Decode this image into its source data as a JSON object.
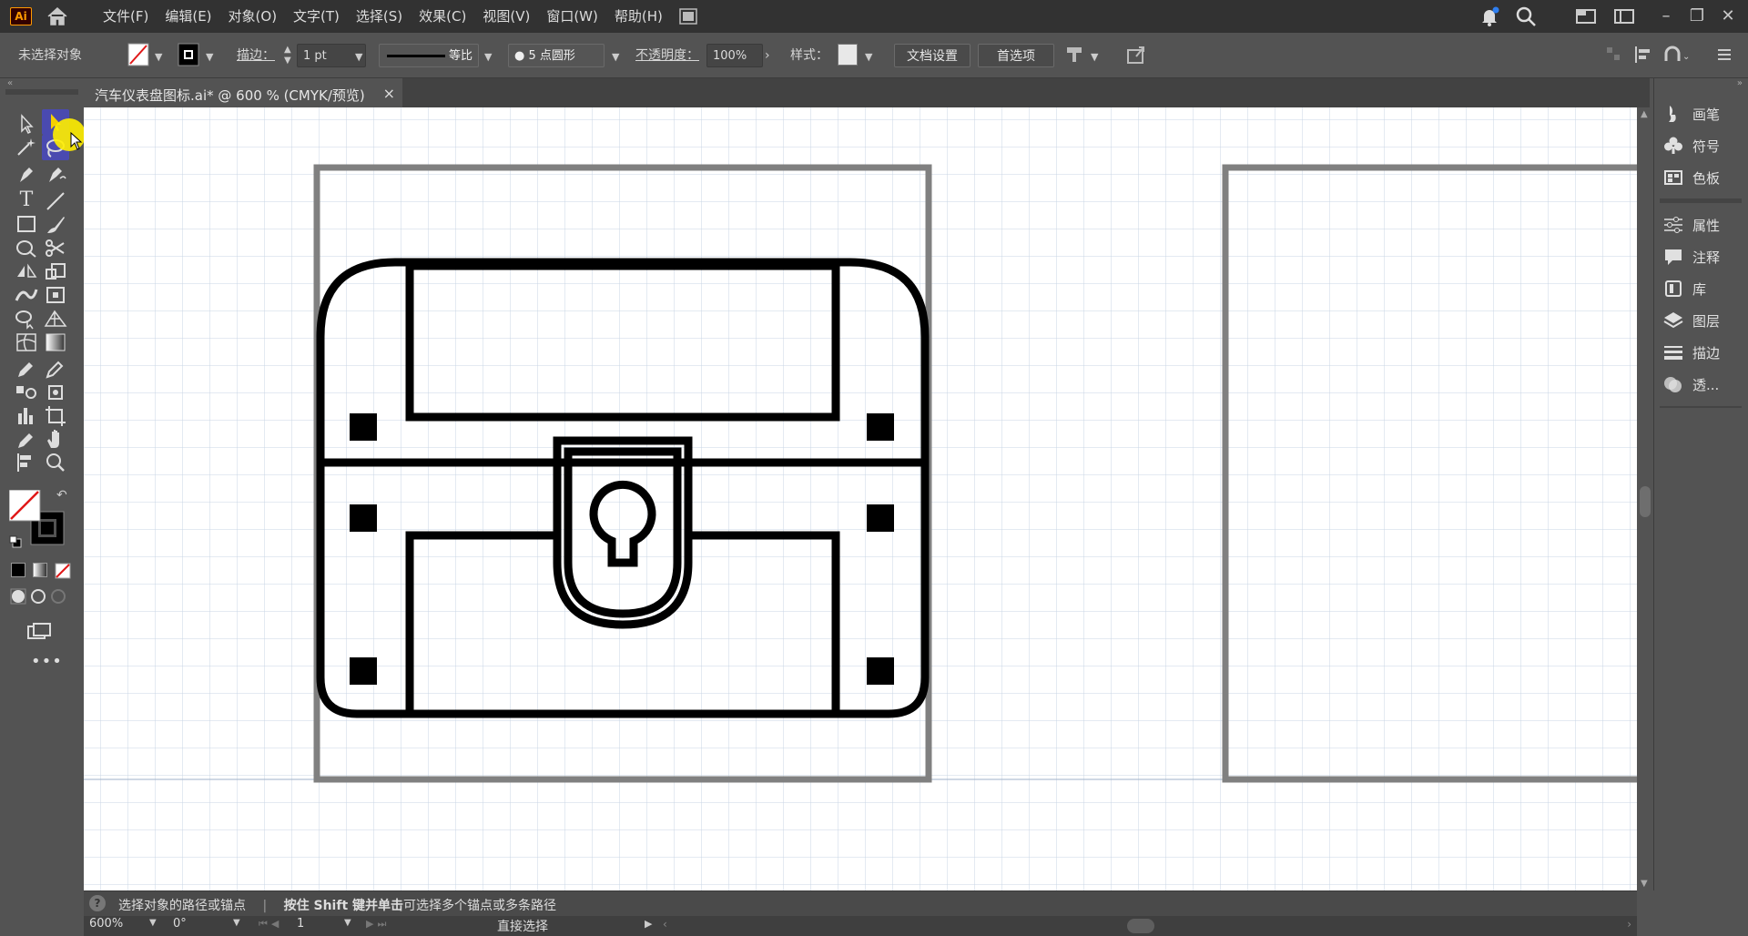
{
  "app": {
    "logo_text": "Ai",
    "accent": "#ff9a00"
  },
  "menubar": {
    "items": [
      "文件(F)",
      "编辑(E)",
      "对象(O)",
      "文字(T)",
      "选择(S)",
      "效果(C)",
      "视图(V)",
      "窗口(W)",
      "帮助(H)"
    ]
  },
  "controlbar": {
    "selection_status": "未选择对象",
    "stroke_label": "描边：",
    "stroke_weight": "1 pt",
    "stroke_profile": "等比",
    "brush_value": "5 点圆形",
    "opacity_label": "不透明度：",
    "opacity_value": "100%",
    "style_label": "样式：",
    "doc_setup_button": "文档设置",
    "prefs_button": "首选项"
  },
  "document_tab": {
    "title": "汽车仪表盘图标.ai* @ 600 % (CMYK/预览)",
    "close": "×"
  },
  "right_panel": {
    "items": [
      {
        "label": "画笔",
        "icon": "brush-icon"
      },
      {
        "label": "符号",
        "icon": "club-symbol-icon"
      },
      {
        "label": "色板",
        "icon": "swatches-icon"
      },
      {
        "label": "属性",
        "icon": "sliders-icon"
      },
      {
        "label": "注释",
        "icon": "comment-icon"
      },
      {
        "label": "库",
        "icon": "library-icon"
      },
      {
        "label": "图层",
        "icon": "layers-icon"
      },
      {
        "label": "描边",
        "icon": "stroke-lines-icon"
      },
      {
        "label": "透...",
        "icon": "transparency-icon"
      }
    ]
  },
  "statusbar": {
    "hint_prefix": "选择对象的路径或锚点",
    "separator": "|",
    "hint_bold": "按住 Shift 键并单击",
    "hint_suffix": "可选择多个锚点或多条路径",
    "zoom": "600%",
    "rotation": "0°",
    "artboard_number": "1",
    "current_tool": "直接选择"
  },
  "colors": {
    "ui_dark": "#323232",
    "ui_mid": "#535353",
    "selected_tool": "#4a4ab0",
    "cursor_highlight": "#ffee00"
  }
}
